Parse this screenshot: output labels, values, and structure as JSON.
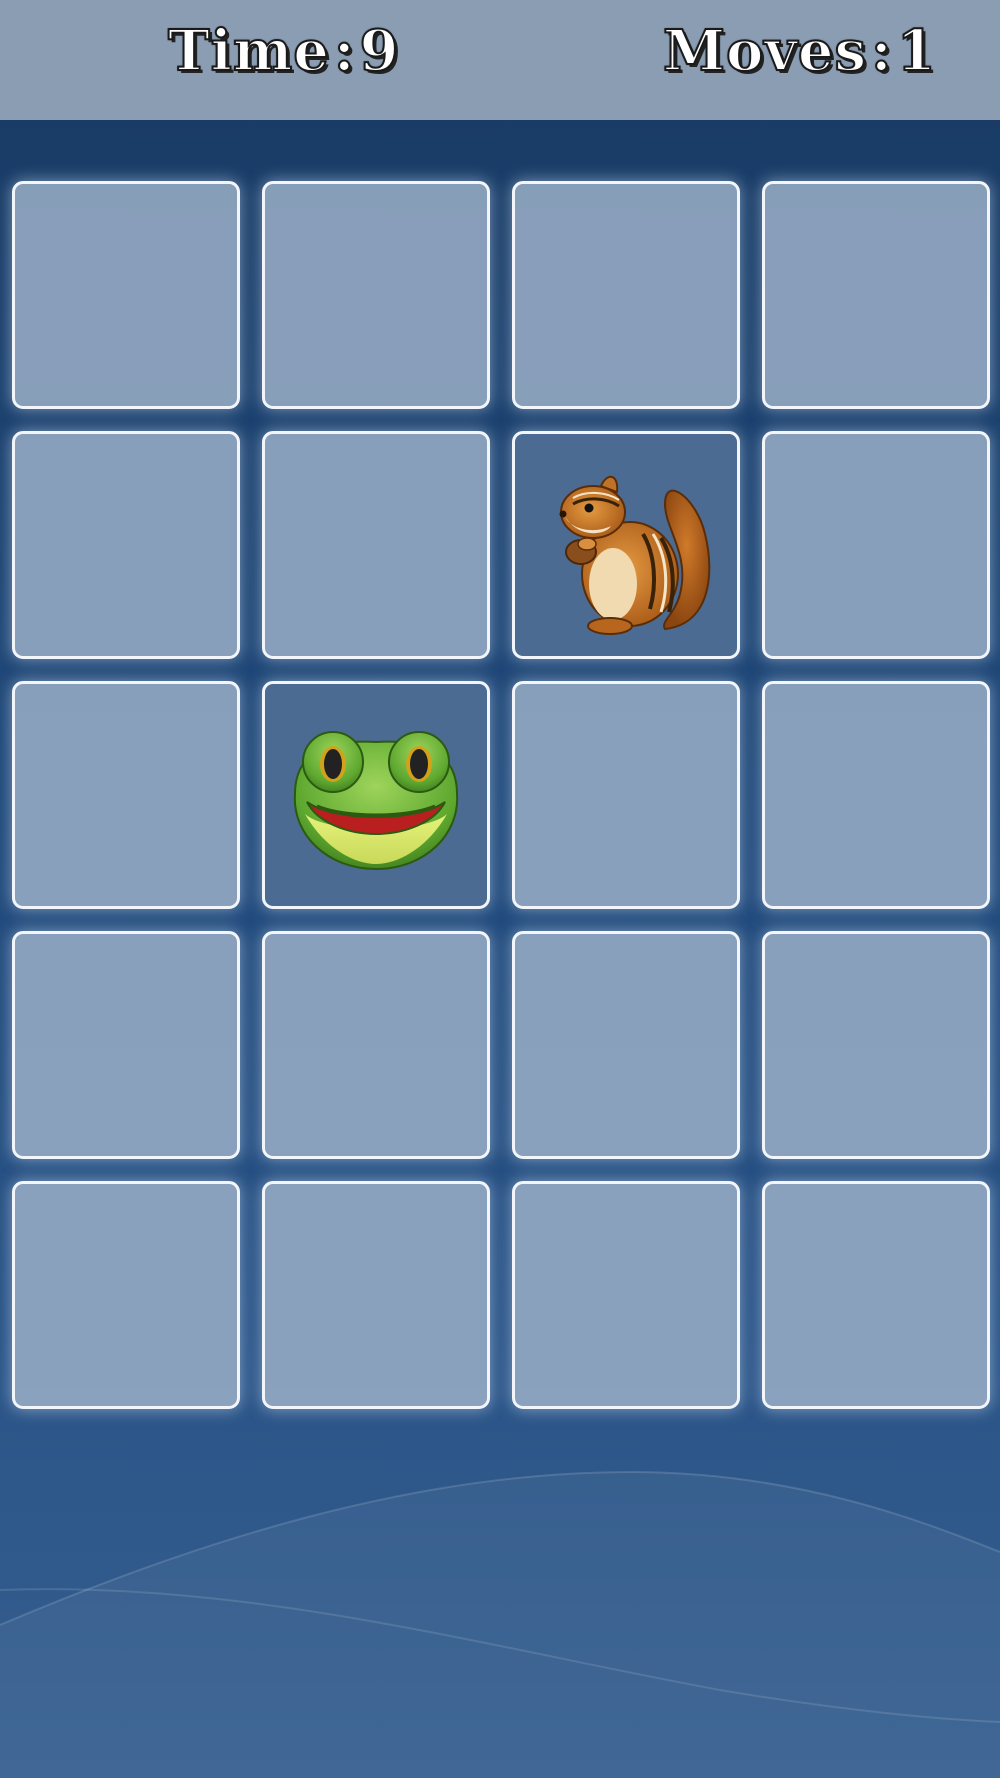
{
  "header": {
    "time_label": "Time",
    "time_value": "9",
    "moves_label": "Moves",
    "moves_value": "1",
    "separator": ":"
  },
  "colors": {
    "header_bg": "#8a9db3",
    "board_bg_top": "#183a63",
    "board_bg_bottom": "#365f90",
    "tile_hidden": "#9bafc8",
    "tile_revealed": "#4b6b93",
    "tile_border": "#f2f5fa"
  },
  "board": {
    "rows": 5,
    "cols": 4,
    "tiles": [
      {
        "state": "hidden"
      },
      {
        "state": "hidden"
      },
      {
        "state": "hidden"
      },
      {
        "state": "hidden"
      },
      {
        "state": "hidden"
      },
      {
        "state": "hidden"
      },
      {
        "state": "revealed",
        "icon": "chipmunk-icon"
      },
      {
        "state": "hidden"
      },
      {
        "state": "hidden"
      },
      {
        "state": "revealed",
        "icon": "frog-icon"
      },
      {
        "state": "hidden"
      },
      {
        "state": "hidden"
      },
      {
        "state": "hidden"
      },
      {
        "state": "hidden"
      },
      {
        "state": "hidden"
      },
      {
        "state": "hidden"
      },
      {
        "state": "hidden"
      },
      {
        "state": "hidden"
      },
      {
        "state": "hidden"
      },
      {
        "state": "hidden"
      }
    ]
  }
}
